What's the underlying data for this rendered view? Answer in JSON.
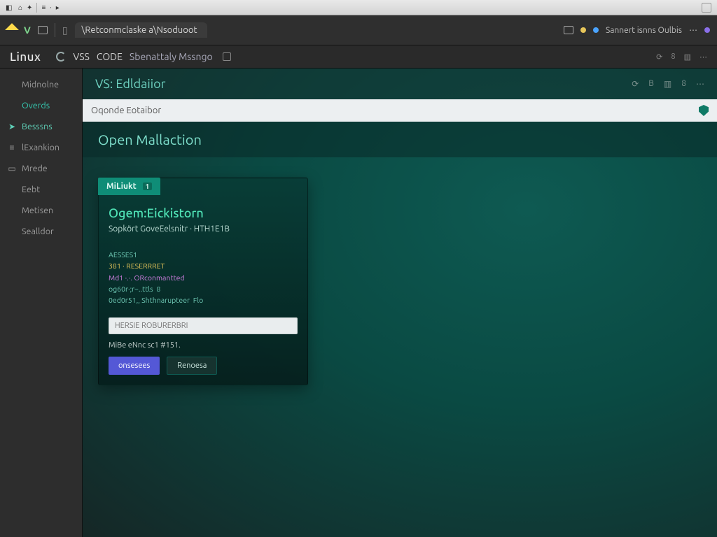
{
  "chrome": {
    "symbols": [
      "◆",
      "□",
      "≡",
      "·",
      "▸"
    ]
  },
  "tabbar": {
    "v_label": "V",
    "active_tab": "\\Retconmclaske a\\Nsoduoot",
    "right_label": "Sannert isnns Oulbis"
  },
  "titlebar": {
    "brand": "Linux",
    "menu1": "VSS",
    "menu2": "CODE",
    "menu3": "Sbenattaly Mssngo"
  },
  "sidebar": {
    "items": [
      {
        "glyph": "",
        "label": "Midnolne"
      },
      {
        "glyph": "",
        "label": "Overds"
      },
      {
        "glyph": "➤",
        "label": "Besssns"
      },
      {
        "glyph": "≡",
        "label": "lExankion"
      },
      {
        "glyph": "▭",
        "label": "Mrede"
      },
      {
        "glyph": "",
        "label": "Eebt"
      },
      {
        "glyph": "",
        "label": "Metisen"
      },
      {
        "glyph": "",
        "label": "Sealldor"
      }
    ]
  },
  "editor": {
    "header": "VS: Edldaiior",
    "search_placeholder": "Oqonde Eotaibor",
    "section": "Open Mallaction"
  },
  "panel": {
    "tab": "MiLiukt",
    "tab_badge": "1",
    "title": "Ogem:Eickistorn",
    "subtitle": "Sopkört GoveEelsnitr · HTH1E1B",
    "code_lines": [
      "AESSES1",
      "381 · RESERRRET",
      "Md1 ·.·. ORconmantted",
      "og60r·;r−..ttls  8",
      "0ed0r51,, Shthnarupteer  Flo"
    ],
    "find_placeholder": "HERSIE ROBURERBRI",
    "hint": "MiBe eNnc sc1  #151.",
    "btn_primary": "onsesees",
    "btn_secondary": "Renoesa"
  }
}
